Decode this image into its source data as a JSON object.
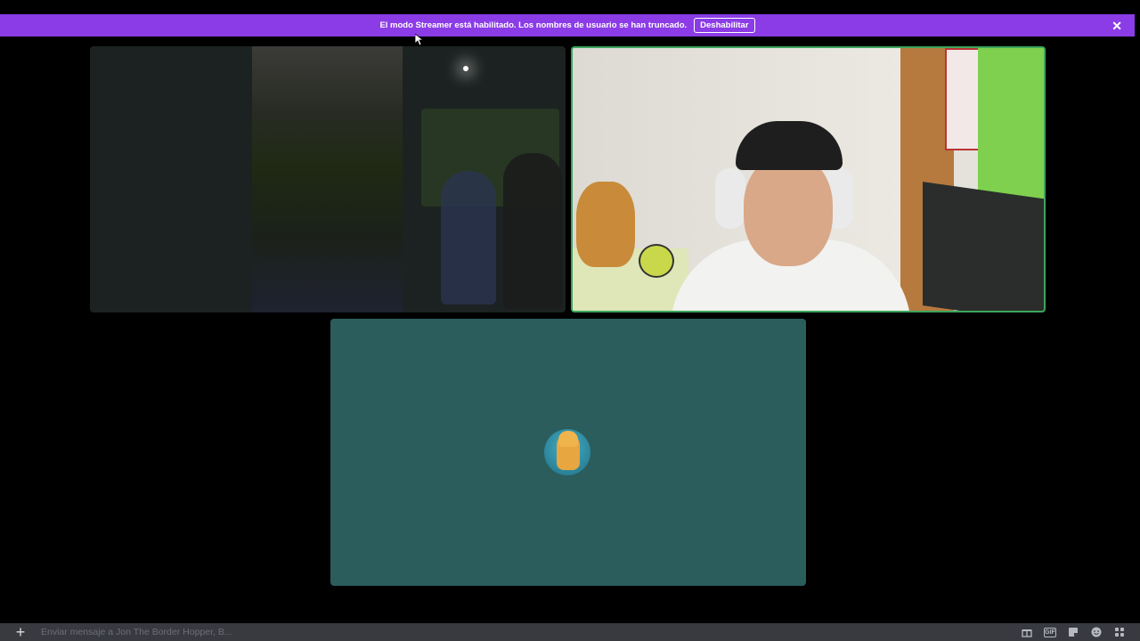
{
  "banner": {
    "message": "El modo Streamer está habilitado. Los nombres de usuario se han truncado.",
    "disable_label": "Deshabilitar",
    "close_icon": "close-icon",
    "color": "#8b3ce6"
  },
  "tiles": [
    {
      "name": "video-tile-dark-room",
      "state": "camera-on"
    },
    {
      "name": "video-tile-speaking",
      "state": "camera-on",
      "speaking_border_color": "#3ba55c"
    },
    {
      "name": "avatar-tile",
      "state": "camera-off",
      "background_color": "#2b5d5d"
    }
  ],
  "chat": {
    "add_icon": "plus-icon",
    "placeholder": "Enviar mensaje a Jon The Border Hopper, B...",
    "icons": [
      "gift-icon",
      "gif-icon",
      "sticker-icon",
      "emoji-icon",
      "apps-icon"
    ],
    "gif_label": "GIF"
  }
}
